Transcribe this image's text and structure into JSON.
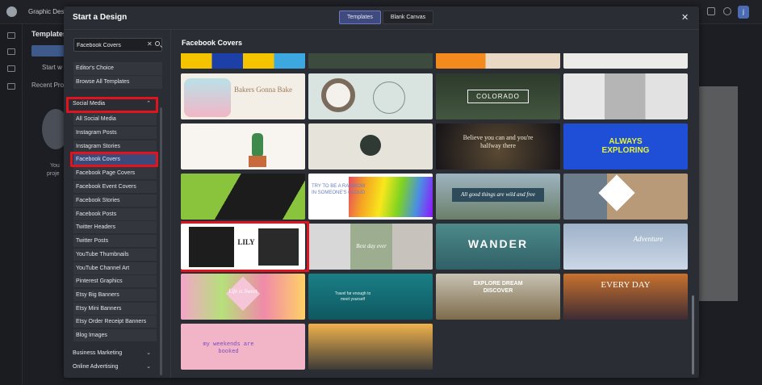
{
  "background": {
    "app_title": "Graphic Desig",
    "templates_heading": "Templates",
    "start_label": "Start w",
    "recent_label": "Recent Pro",
    "empty_line1": "You",
    "empty_line2": "proje",
    "avatar_letter": "j"
  },
  "modal": {
    "title": "Start a Design",
    "tabs": [
      "Templates",
      "Blank Canvas"
    ],
    "active_tab": "Templates",
    "close_icon": "close-icon",
    "search": {
      "value": "Facebook Covers",
      "clear_glyph": "✕"
    },
    "quick_links": [
      "Editor's Choice",
      "Browse All Templates"
    ],
    "categories": {
      "social_media": {
        "label": "Social Media",
        "chevron": "⌃",
        "items": [
          "All Social Media",
          "Instagram Posts",
          "Instagram Stories",
          "Facebook Covers",
          "Facebook Page Covers",
          "Facebook Event Covers",
          "Facebook Stories",
          "Facebook Posts",
          "Twitter Headers",
          "Twitter Posts",
          "YouTube Thumbnails",
          "YouTube Channel Art",
          "Pinterest Graphics",
          "Etsy Big Banners",
          "Etsy Mini Banners",
          "Etsy Order Receipt Banners",
          "Blog Images"
        ],
        "active_item": "Facebook Covers"
      },
      "business_marketing": {
        "label": "Business Marketing",
        "chevron": "⌄"
      },
      "online_advertising": {
        "label": "Online Advertising",
        "chevron": "⌄"
      }
    },
    "content_title": "Facebook Covers",
    "templates": [
      {
        "caption": "Bakers Gonna Bake"
      },
      {
        "caption": "COLORADO"
      },
      {
        "caption": "Believe you can and you're halfway there"
      },
      {
        "caption": "ALWAYS EXPLORING"
      },
      {
        "caption": "TRY TO BE A RAINBOW IN SOMEONE'S CLOUD"
      },
      {
        "caption": "All good things are wild and free"
      },
      {
        "caption": "WANDER"
      },
      {
        "caption": "Adventure"
      },
      {
        "caption": "Best day ever"
      },
      {
        "caption": "LILY"
      },
      {
        "caption": "Life is Sweet"
      },
      {
        "caption": "Travel far enough to meet yourself"
      },
      {
        "caption": "EXPLORE DREAM DISCOVER"
      },
      {
        "caption": "EVERY DAY"
      },
      {
        "caption": "my weekends are booked"
      }
    ]
  },
  "colors": {
    "modal_bg": "#2a2d33",
    "active_item": "#3d4979",
    "highlight": "#e0141e"
  }
}
